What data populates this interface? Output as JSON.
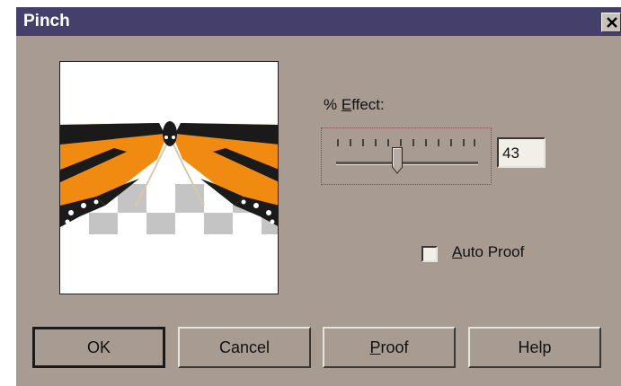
{
  "window": {
    "title": "Pinch",
    "close_icon": "close-icon"
  },
  "effect": {
    "label_prefix": "% ",
    "label_mnemonic": "E",
    "label_rest": "ffect:",
    "value": "43",
    "slider_fraction": 0.43
  },
  "auto_proof": {
    "label_mnemonic": "A",
    "label_rest": "uto Proof",
    "checked": false
  },
  "buttons": {
    "ok": "OK",
    "cancel": "Cancel",
    "proof_mnemonic": "P",
    "proof_rest": "roof",
    "help": "Help"
  },
  "colors": {
    "dialog_bg": "#a79b92",
    "titlebar": "#44406b",
    "butterfly_orange": "#f08a10"
  }
}
